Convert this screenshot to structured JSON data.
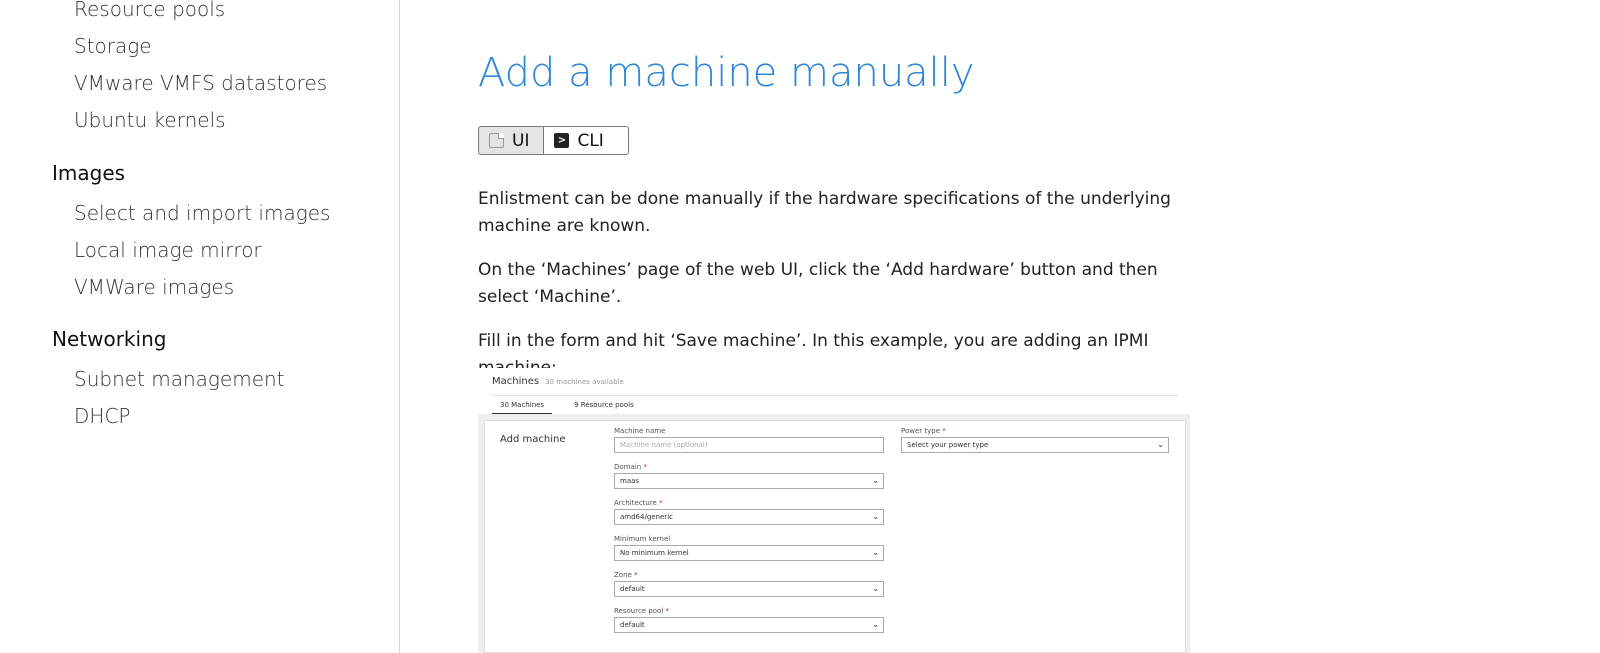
{
  "sidebar": {
    "items": [
      {
        "label": "Resource pools",
        "type": "item"
      },
      {
        "label": "Storage",
        "type": "item"
      },
      {
        "label": "VMware VMFS datastores",
        "type": "item"
      },
      {
        "label": "Ubuntu kernels",
        "type": "item"
      },
      {
        "label": "Images",
        "type": "heading"
      },
      {
        "label": "Select and import images",
        "type": "item"
      },
      {
        "label": "Local image mirror",
        "type": "item"
      },
      {
        "label": "VMWare images",
        "type": "item"
      },
      {
        "label": "Networking",
        "type": "heading"
      },
      {
        "label": "Subnet management",
        "type": "item"
      },
      {
        "label": "DHCP",
        "type": "item"
      }
    ]
  },
  "main": {
    "title": "Add a machine manually",
    "tabs": [
      {
        "label": "UI",
        "icon": "document-icon",
        "active": true
      },
      {
        "label": "CLI",
        "icon": "terminal-icon",
        "active": false
      }
    ],
    "paragraphs": [
      "Enlistment can be done manually if the hardware specifications of the underlying machine are known.",
      "On the ‘Machines’ page of the web UI, click the ‘Add hardware’ button and then select ‘Machine’.",
      "Fill in the form and hit ‘Save machine’. In this example, you are adding an IPMI machine:"
    ]
  },
  "screenshot": {
    "header": "Machines",
    "header_sub": "30 machines available",
    "tabs": [
      "30 Machines",
      "9 Resource pools"
    ],
    "panel_title": "Add machine",
    "fields": {
      "machine_name": {
        "label": "Machine name",
        "placeholder": "Machine name (optional)"
      },
      "domain": {
        "label": "Domain",
        "value": "maas"
      },
      "architecture": {
        "label": "Architecture",
        "value": "amd64/generic"
      },
      "min_kernel": {
        "label": "Minimum kernel",
        "value": "No minimum kernel"
      },
      "zone": {
        "label": "Zone",
        "value": "default"
      },
      "resource_pool": {
        "label": "Resource pool",
        "value": "default"
      },
      "power_type": {
        "label": "Power type",
        "value": "Select your power type"
      }
    }
  },
  "colors": {
    "title": "#2d86d8",
    "required": "#c7162b"
  }
}
